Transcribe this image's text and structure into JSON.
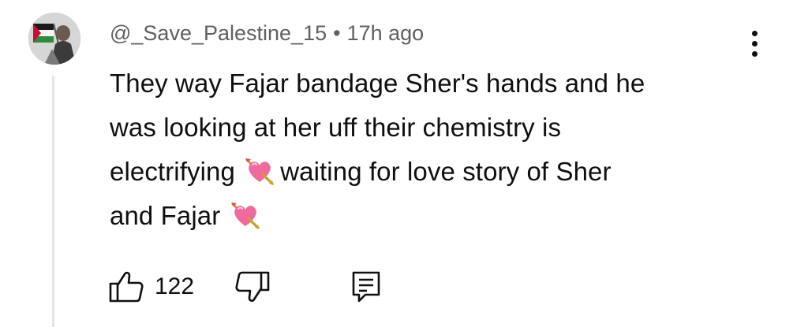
{
  "comment": {
    "author": "@_Save_Palestine_15",
    "separator": "•",
    "time": "17h ago",
    "lines": [
      "They way Fajar bandage Sher's hands and he",
      "was looking at her uff their chemistry is",
      "electrifying",
      "waiting for love story of Sher",
      "and Fajar"
    ],
    "emoji": "heart-with-arrow-emoji",
    "likes": "122"
  },
  "icons": {
    "avatar": "avatar-image",
    "menu": "more-vertical-icon",
    "like": "thumb-up-icon",
    "dislike": "thumb-down-icon",
    "reply": "reply-comment-icon"
  },
  "colors": {
    "text": "#0f0f0f",
    "secondary": "#606060",
    "thread_line": "#e5e5e5",
    "emoji_heart": "#f06a9e"
  }
}
